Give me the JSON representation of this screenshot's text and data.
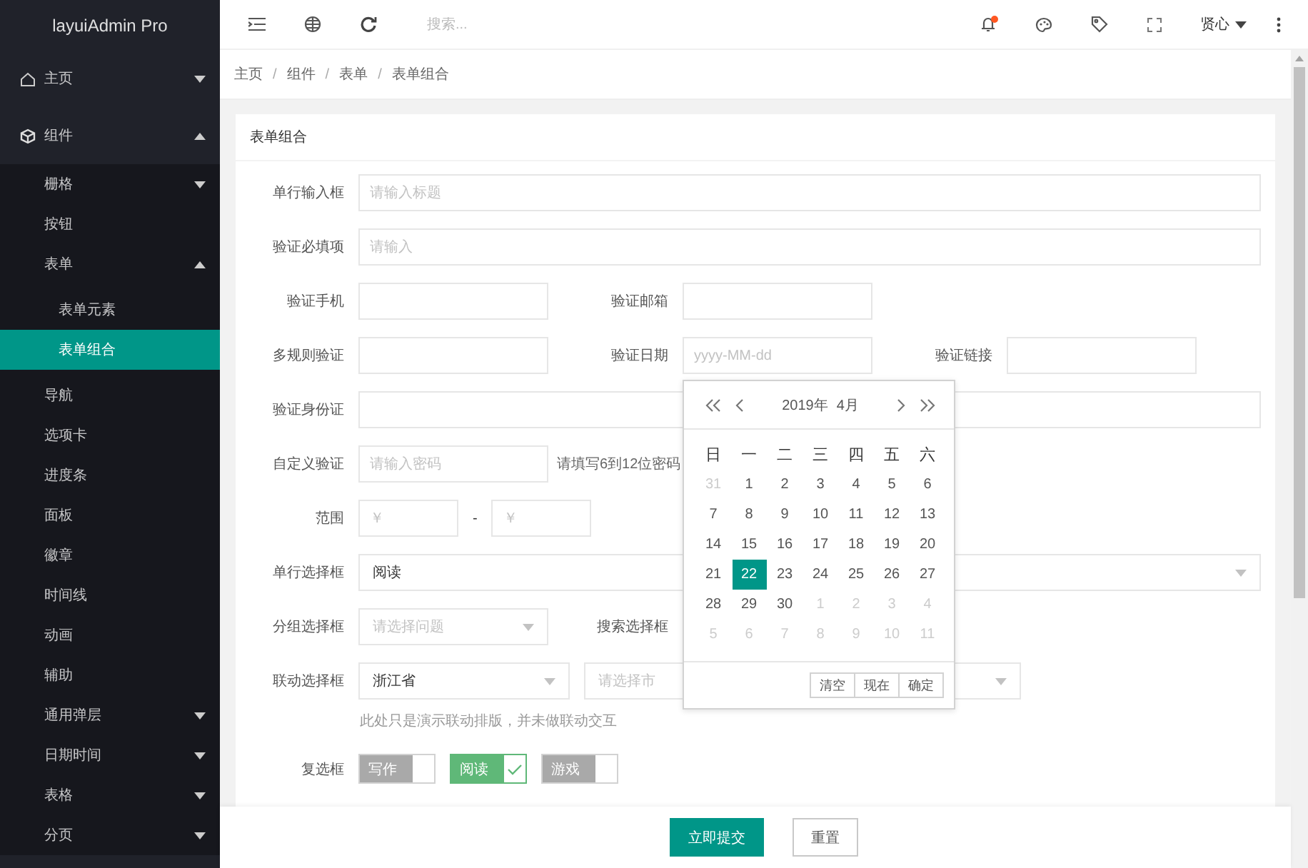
{
  "app": {
    "logo": "layuiAdmin Pro"
  },
  "sidebar": {
    "items": [
      {
        "kind": "menu",
        "label": "主页",
        "expanded": false
      },
      {
        "kind": "menu",
        "label": "组件",
        "expanded": true,
        "children": [
          {
            "kind": "menu",
            "label": "栅格",
            "expanded": false
          },
          {
            "kind": "link",
            "label": "按钮",
            "selected": false
          },
          {
            "kind": "menu",
            "label": "表单",
            "expanded": true,
            "children": [
              {
                "kind": "link",
                "label": "表单元素",
                "selected": false
              },
              {
                "kind": "link",
                "label": "表单组合",
                "selected": true
              }
            ]
          },
          {
            "kind": "link",
            "label": "导航",
            "selected": false
          },
          {
            "kind": "link",
            "label": "选项卡",
            "selected": false
          },
          {
            "kind": "link",
            "label": "进度条",
            "selected": false
          },
          {
            "kind": "link",
            "label": "面板",
            "selected": false
          },
          {
            "kind": "link",
            "label": "徽章",
            "selected": false
          },
          {
            "kind": "link",
            "label": "时间线",
            "selected": false
          },
          {
            "kind": "link",
            "label": "动画",
            "selected": false
          },
          {
            "kind": "link",
            "label": "辅助",
            "selected": false
          },
          {
            "kind": "menu",
            "label": "通用弹层",
            "expanded": false
          },
          {
            "kind": "menu",
            "label": "日期时间",
            "expanded": false
          },
          {
            "kind": "menu",
            "label": "表格",
            "expanded": false
          },
          {
            "kind": "menu",
            "label": "分页",
            "expanded": false
          }
        ]
      }
    ]
  },
  "header": {
    "search": {
      "placeholder": "搜索..."
    },
    "notification_dot": true,
    "user": "贤心"
  },
  "breadcrumb": {
    "items": [
      "主页",
      "组件",
      "表单",
      "表单组合"
    ],
    "separator": "/"
  },
  "form": {
    "title": "表单组合",
    "rows": [
      {
        "fields": [
          {
            "kind": "input",
            "label": "单行输入框",
            "placeholder": "请输入标题"
          }
        ]
      },
      {
        "fields": [
          {
            "kind": "input",
            "label": "验证必填项",
            "placeholder": "请输入"
          }
        ]
      },
      {
        "fields": [
          {
            "kind": "input",
            "label": "验证手机"
          },
          {
            "kind": "input",
            "label": "验证邮箱"
          }
        ]
      },
      {
        "fields": [
          {
            "kind": "input",
            "label": "多规则验证"
          },
          {
            "kind": "date",
            "label": "验证日期",
            "placeholder": "yyyy-MM-dd",
            "picker_open": true
          },
          {
            "kind": "input",
            "label": "验证链接"
          }
        ]
      },
      {
        "fields": [
          {
            "kind": "input",
            "label": "验证身份证"
          }
        ]
      },
      {
        "fields": [
          {
            "kind": "input",
            "label": "自定义验证",
            "placeholder": "请输入密码",
            "hint": "请填写6到12位密码"
          }
        ]
      },
      {
        "fields": [
          {
            "kind": "range",
            "label": "范围",
            "placeholders": [
              "￥",
              "￥"
            ],
            "separator": "-"
          }
        ]
      },
      {
        "fields": [
          {
            "kind": "select",
            "label": "单行选择框",
            "value": "阅读"
          }
        ]
      },
      {
        "fields": [
          {
            "kind": "select",
            "label": "分组选择框",
            "placeholder": "请选择问题"
          },
          {
            "kind": "select",
            "label": "搜索选择框"
          }
        ]
      },
      {
        "fields": [
          {
            "kind": "cascade",
            "label": "联动选择框",
            "selects": [
              {
                "kind": "select",
                "value": "浙江省"
              },
              {
                "kind": "select",
                "placeholder": "请选择市"
              },
              {
                "kind": "select"
              }
            ]
          }
        ],
        "note": "此处只是演示联动排版，并未做联动交互"
      },
      {
        "fields": [
          {
            "kind": "checkboxes",
            "label": "复选框",
            "options": [
              {
                "label": "写作",
                "checked": false
              },
              {
                "label": "阅读",
                "checked": true
              },
              {
                "label": "游戏",
                "checked": false
              }
            ]
          }
        ]
      }
    ]
  },
  "date_picker": {
    "year": "2019年",
    "month": "4月",
    "weekdays": [
      "日",
      "一",
      "二",
      "三",
      "四",
      "五",
      "六"
    ],
    "days": [
      {
        "day": "31",
        "muted": true,
        "selected": false
      },
      {
        "day": "1",
        "muted": false,
        "selected": false
      },
      {
        "day": "2",
        "muted": false,
        "selected": false
      },
      {
        "day": "3",
        "muted": false,
        "selected": false
      },
      {
        "day": "4",
        "muted": false,
        "selected": false
      },
      {
        "day": "5",
        "muted": false,
        "selected": false
      },
      {
        "day": "6",
        "muted": false,
        "selected": false
      },
      {
        "day": "7",
        "muted": false,
        "selected": false
      },
      {
        "day": "8",
        "muted": false,
        "selected": false
      },
      {
        "day": "9",
        "muted": false,
        "selected": false
      },
      {
        "day": "10",
        "muted": false,
        "selected": false
      },
      {
        "day": "11",
        "muted": false,
        "selected": false
      },
      {
        "day": "12",
        "muted": false,
        "selected": false
      },
      {
        "day": "13",
        "muted": false,
        "selected": false
      },
      {
        "day": "14",
        "muted": false,
        "selected": false
      },
      {
        "day": "15",
        "muted": false,
        "selected": false
      },
      {
        "day": "16",
        "muted": false,
        "selected": false
      },
      {
        "day": "17",
        "muted": false,
        "selected": false
      },
      {
        "day": "18",
        "muted": false,
        "selected": false
      },
      {
        "day": "19",
        "muted": false,
        "selected": false
      },
      {
        "day": "20",
        "muted": false,
        "selected": false
      },
      {
        "day": "21",
        "muted": false,
        "selected": false
      },
      {
        "day": "22",
        "muted": false,
        "selected": true
      },
      {
        "day": "23",
        "muted": false,
        "selected": false
      },
      {
        "day": "24",
        "muted": false,
        "selected": false
      },
      {
        "day": "25",
        "muted": false,
        "selected": false
      },
      {
        "day": "26",
        "muted": false,
        "selected": false
      },
      {
        "day": "27",
        "muted": false,
        "selected": false
      },
      {
        "day": "28",
        "muted": false,
        "selected": false
      },
      {
        "day": "29",
        "muted": false,
        "selected": false
      },
      {
        "day": "30",
        "muted": false,
        "selected": false
      },
      {
        "day": "1",
        "muted": true,
        "selected": false
      },
      {
        "day": "2",
        "muted": true,
        "selected": false
      },
      {
        "day": "3",
        "muted": true,
        "selected": false
      },
      {
        "day": "4",
        "muted": true,
        "selected": false
      },
      {
        "day": "5",
        "muted": true,
        "selected": false
      },
      {
        "day": "6",
        "muted": true,
        "selected": false
      },
      {
        "day": "7",
        "muted": true,
        "selected": false
      },
      {
        "day": "8",
        "muted": true,
        "selected": false
      },
      {
        "day": "9",
        "muted": true,
        "selected": false
      },
      {
        "day": "10",
        "muted": true,
        "selected": false
      },
      {
        "day": "11",
        "muted": true,
        "selected": false
      }
    ],
    "buttons": [
      "清空",
      "现在",
      "确定"
    ]
  },
  "footer": {
    "buttons": [
      {
        "kind": "primary",
        "label": "立即提交"
      },
      {
        "kind": "default",
        "label": "重置"
      }
    ]
  }
}
